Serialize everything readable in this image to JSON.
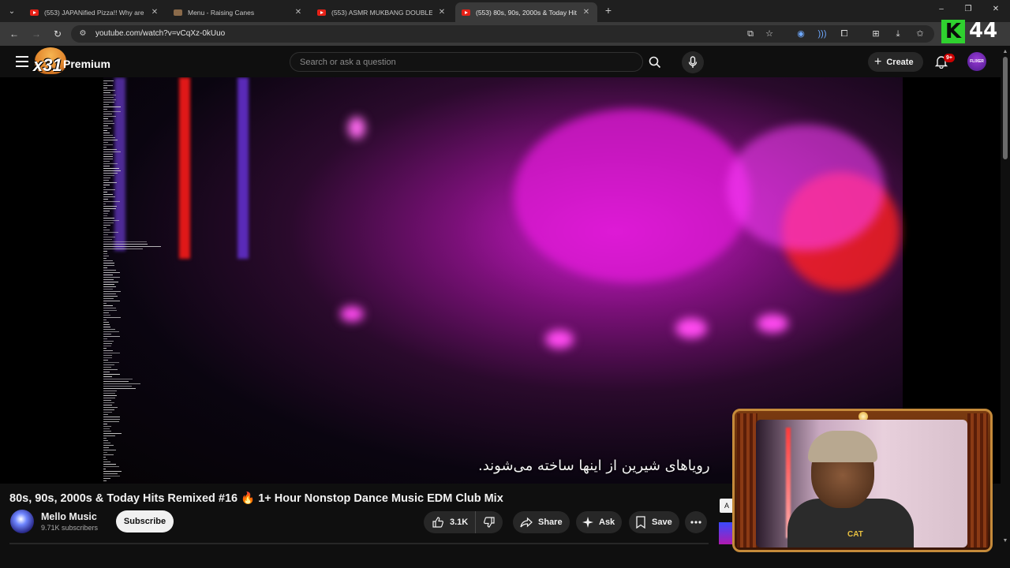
{
  "browser": {
    "tabs": [
      {
        "title": "(553) JAPANified Pizza!! Why are th",
        "favicon": "youtube-icon",
        "active": false
      },
      {
        "title": "Menu - Raising Canes",
        "favicon": "raising-canes-icon",
        "active": false
      },
      {
        "title": "(553) ASMR MUKBANG DOUBLE H",
        "favicon": "youtube-icon",
        "active": false
      },
      {
        "title": "(553) 80s, 90s, 2000s & Today Hits",
        "favicon": "youtube-icon",
        "active": true
      }
    ],
    "url": "youtube.com/watch?v=vCqXz-0kUuo"
  },
  "stream_overlay": {
    "k_label": "K",
    "count": "44",
    "accent_color": "#2fd12f"
  },
  "masthead": {
    "logo_text": "x31",
    "premium_label": "Premium",
    "search_placeholder": "Search or ask a question",
    "create_label": "Create",
    "notification_badge": "9+",
    "avatar_text": "FLIXER"
  },
  "player": {
    "subtitle": "رویاهای شیرین از اینها ساخته می‌شوند."
  },
  "video": {
    "title": "80s, 90s, 2000s & Today Hits Remixed #16 🔥 1+ Hour Nonstop Dance Music EDM Club Mix",
    "channel_name": "Mello Music",
    "channel_subscribers": "9.71K subscribers",
    "subscribe_label": "Subscribe",
    "like_count": "3.1K",
    "share_label": "Share",
    "ask_label": "Ask",
    "save_label": "Save"
  },
  "webcam": {
    "shirt_logo": "CAT",
    "side_label": "A"
  },
  "colors": {
    "background": "#0f0f0f",
    "pill": "#272727",
    "brand_red": "#cc0000"
  }
}
